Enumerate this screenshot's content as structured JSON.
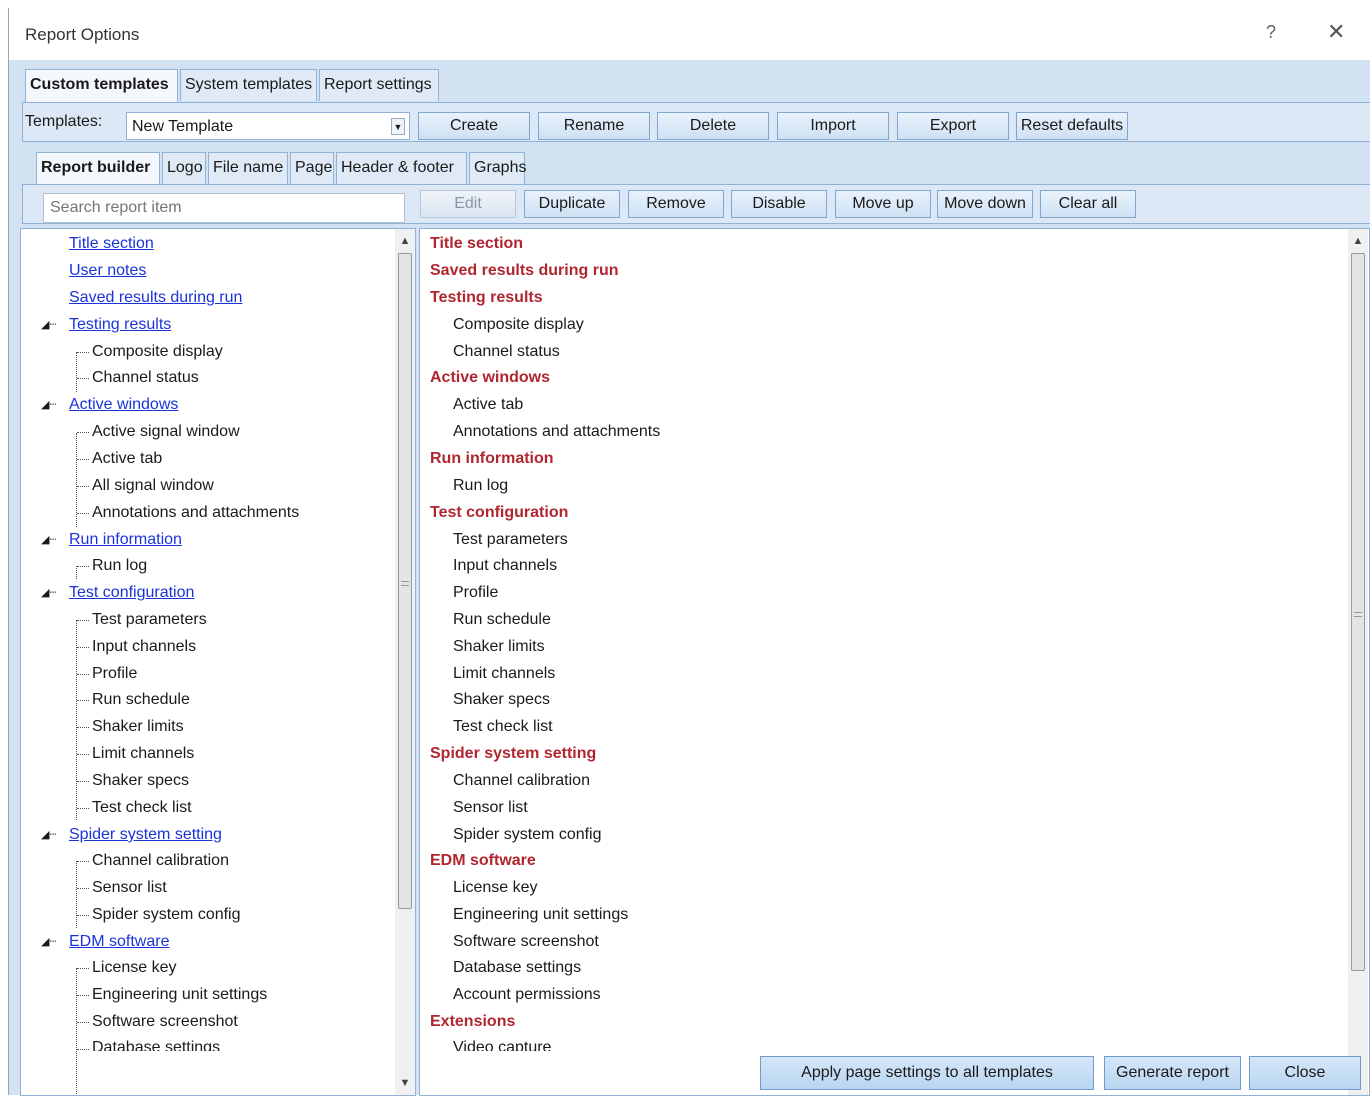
{
  "window": {
    "title": "Report Options",
    "help_glyph": "?",
    "close_glyph": "✕"
  },
  "top_tabs": [
    "Custom templates",
    "System templates",
    "Report settings"
  ],
  "templates": {
    "label": "Templates:",
    "selected": "New Template",
    "buttons": [
      "Create",
      "Rename",
      "Delete",
      "Import",
      "Export",
      "Reset defaults"
    ]
  },
  "sub_tabs": [
    "Report builder",
    "Logo",
    "File name",
    "Page",
    "Header & footer",
    "Graphs"
  ],
  "search": {
    "placeholder": "Search report item"
  },
  "actions": [
    "Edit",
    "Duplicate",
    "Remove",
    "Disable",
    "Move up",
    "Move down",
    "Clear all"
  ],
  "tree": [
    "Title section",
    "User notes",
    "Saved results during run",
    "Testing results",
    "Composite display",
    "Channel status",
    "Active windows",
    "Active signal window",
    "Active tab",
    "All signal window",
    "Annotations and attachments",
    "Run information",
    "Run log",
    "Test configuration",
    "Test parameters",
    "Input channels",
    "Profile",
    "Run schedule",
    "Shaker limits",
    "Limit channels",
    "Shaker specs",
    "Test check list",
    "Spider system setting",
    "Channel calibration",
    "Sensor list",
    "Spider system config",
    "EDM software",
    "License key",
    "Engineering unit settings",
    "Software screenshot",
    "Database settings"
  ],
  "report": [
    "Title section",
    "Saved results during run",
    "Testing results",
    "Composite display",
    "Channel status",
    "Active windows",
    "Active tab",
    "Annotations and attachments",
    "Run information",
    "Run log",
    "Test configuration",
    "Test parameters",
    "Input channels",
    "Profile",
    "Run schedule",
    "Shaker limits",
    "Limit channels",
    "Shaker specs",
    "Test check list",
    "Spider system setting",
    "Channel calibration",
    "Sensor list",
    "Spider system config",
    "EDM software",
    "License key",
    "Engineering unit settings",
    "Software screenshot",
    "Database settings",
    "Account permissions",
    "Extensions",
    "Video capture"
  ],
  "footer": [
    "Apply page settings to all templates",
    "Generate report",
    "Close"
  ]
}
